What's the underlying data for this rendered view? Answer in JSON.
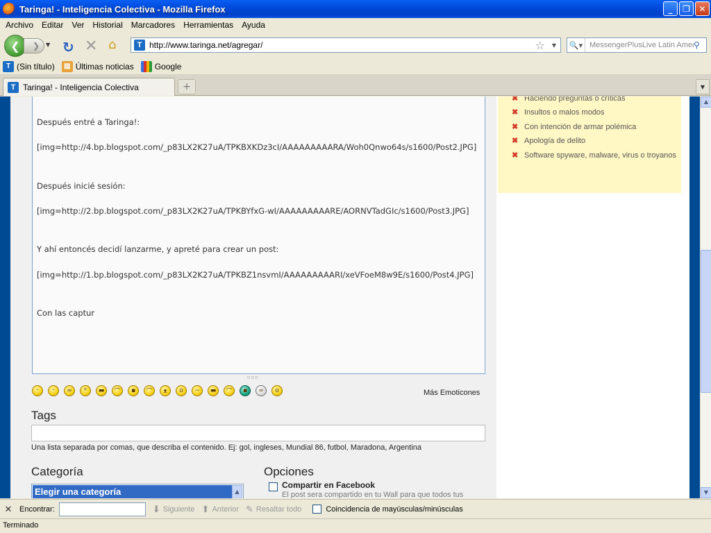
{
  "window": {
    "title": "Taringa! - Inteligencia Colectiva - Mozilla Firefox"
  },
  "menu": [
    "Archivo",
    "Editar",
    "Ver",
    "Historial",
    "Marcadores",
    "Herramientas",
    "Ayuda"
  ],
  "nav": {
    "url": "http://www.taringa.net/agregar/",
    "search_placeholder": "MessengerPlusLive Latin Amer"
  },
  "bookmarks": [
    {
      "label": "(Sin título)",
      "icon": "taringa-icon"
    },
    {
      "label": "Últimas noticias",
      "icon": "rss-feed-icon"
    },
    {
      "label": "Google",
      "icon": "google-icon"
    }
  ],
  "tab": {
    "title": "Taringa! - Inteligencia Colectiva"
  },
  "editor": {
    "lines": [
      "Después entré a Taringa!:",
      "[img=http://4.bp.blogspot.com/_p83LX2K27uA/TPKBXKDz3cI/AAAAAAAAARA/Woh0Qnwo64s/s1600/Post2.JPG]",
      "Después inicié sesión:",
      "[img=http://2.bp.blogspot.com/_p83LX2K27uA/TPKBYfxG-wI/AAAAAAAAARE/AORNVTadGIc/s1600/Post3.JPG]",
      "Y ahí entoncés decidí lanzarme, y apreté para crear un post:",
      "[img=http://1.bp.blogspot.com/_p83LX2K27uA/TPKBZ1nsvmI/AAAAAAAAARI/xeVFoeM8w9E/s1600/Post4.JPG]",
      "Con las captur"
    ]
  },
  "emoticons": {
    "icons": [
      "smile-emoticon-icon",
      "wink-emoticon-icon",
      "cool-emoticon-icon",
      "tongue-emoticon-icon",
      "grin-emoticon-icon",
      "sad-emoticon-icon",
      "angry-emoticon-icon",
      "worried-emoticon-icon",
      "devil-emoticon-icon",
      "surprised-emoticon-icon",
      "confused-emoticon-icon",
      "sunglasses-emoticon-icon",
      "cry-emoticon-icon",
      "alien-emoticon-icon",
      "nerd-emoticon-icon",
      "scared-emoticon-icon"
    ],
    "more_label": "Más Emoticones"
  },
  "tags": {
    "title": "Tags",
    "value": "",
    "hint": "Una lista separada por comas, que describa el contenido. Ej: gol, ingleses, Mundial 86, futbol, Maradona, Argentina"
  },
  "categoria": {
    "title": "Categoría",
    "selected": "Elegir una categoría"
  },
  "opciones": {
    "title": "Opciones",
    "facebook_label": "Compartir en Facebook",
    "facebook_desc": "El post sera compartido en tu Wall para que todos tus"
  },
  "rules": [
    "Haciendo preguntas o críticas",
    "Insultos o malos modos",
    "Con intención de armar polémica",
    "Apología de delito",
    "Software spyware, malware, virus o troyanos"
  ],
  "findbar": {
    "label": "Encontrar:",
    "value": "",
    "next": "Siguiente",
    "prev": "Anterior",
    "highlight": "Resaltar todo",
    "match_case": "Coincidencia de mayúsculas/minúsculas"
  },
  "status": "Terminado",
  "colors": {
    "page_border": "#004a94",
    "rules_bg": "#fff7c4",
    "rule_x": "#d23b2b",
    "selection": "#316ac5"
  }
}
